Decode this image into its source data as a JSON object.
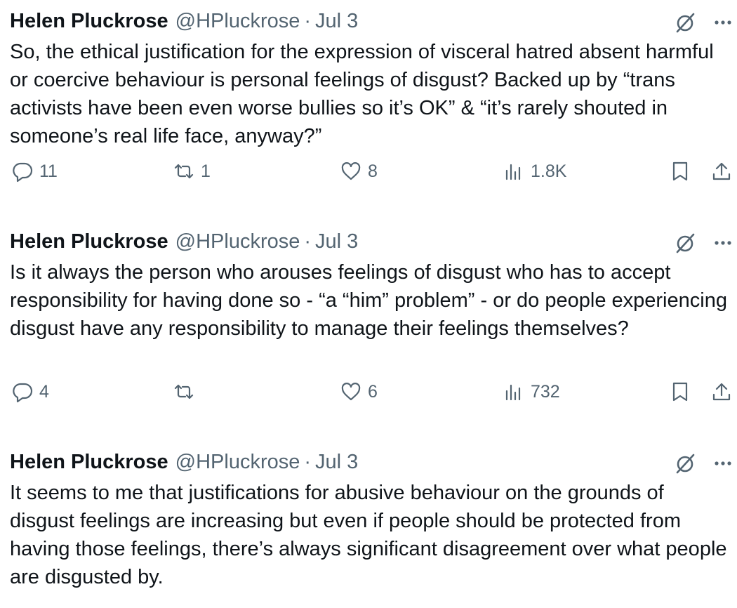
{
  "tweets": [
    {
      "name": "Helen Pluckrose",
      "handle": "@HPluckrose",
      "separator": "·",
      "date": "Jul 3",
      "text": "So, the ethical justification for the expression of visceral hatred absent harmful or coercive behaviour is personal feelings of disgust? Backed up by “trans activists have been even worse bullies so it’s OK” & “it’s rarely shouted in someone’s real life face, anyway?”",
      "replies": "11",
      "reposts": "1",
      "likes": "8",
      "views": "1.8K"
    },
    {
      "name": "Helen Pluckrose",
      "handle": "@HPluckrose",
      "separator": "·",
      "date": "Jul 3",
      "text": "Is it always the person who arouses feelings of disgust who has to accept responsibility for having done so - “a “him” problem” - or do people experiencing disgust have any responsibility to manage their feelings themselves?",
      "replies": "4",
      "reposts": "",
      "likes": "6",
      "views": "732"
    },
    {
      "name": "Helen Pluckrose",
      "handle": "@HPluckrose",
      "separator": "·",
      "date": "Jul 3",
      "text": "It seems to me that justifications for abusive behaviour on the grounds of disgust feelings are increasing but even if people should be protected from having those feelings, there’s always significant disagreement over what people are disgusted by."
    }
  ],
  "icons": {
    "grok": "grok-icon",
    "more": "more-icon",
    "reply": "reply-icon",
    "repost": "repost-icon",
    "like": "like-icon",
    "views": "views-icon",
    "bookmark": "bookmark-icon",
    "share": "share-icon"
  },
  "colors": {
    "text": "#0f1419",
    "secondary": "#536471"
  }
}
